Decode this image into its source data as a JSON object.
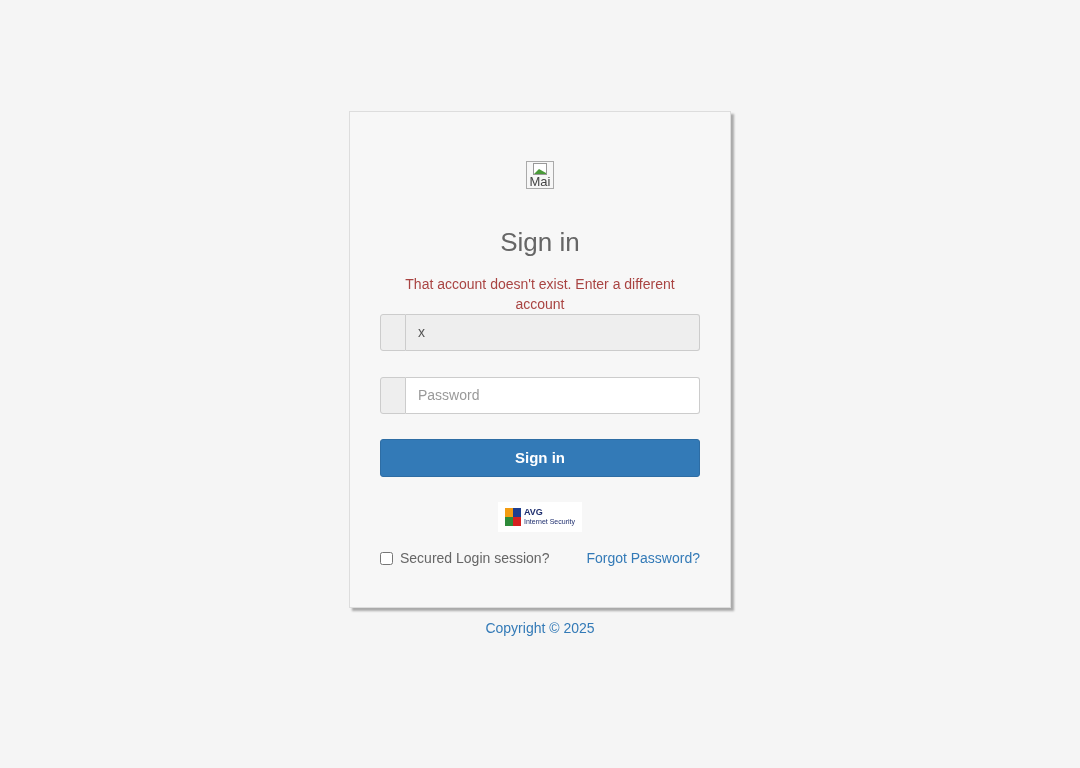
{
  "logo": {
    "alt_text": "Mai"
  },
  "title": "Sign in",
  "error": "That account doesn't exist. Enter a different account",
  "fields": [
    {
      "kind": "text",
      "value": "x",
      "disabled": true
    },
    {
      "kind": "password",
      "placeholder": "Password",
      "disabled": false
    }
  ],
  "submit_button": "Sign in",
  "badge": {
    "name": "AVG",
    "subtitle": "Internet Security"
  },
  "secured_session": {
    "label": "Secured Login session?",
    "checked": false
  },
  "forgot_link": "Forgot Password?",
  "footer": "Copyright © 2025"
}
